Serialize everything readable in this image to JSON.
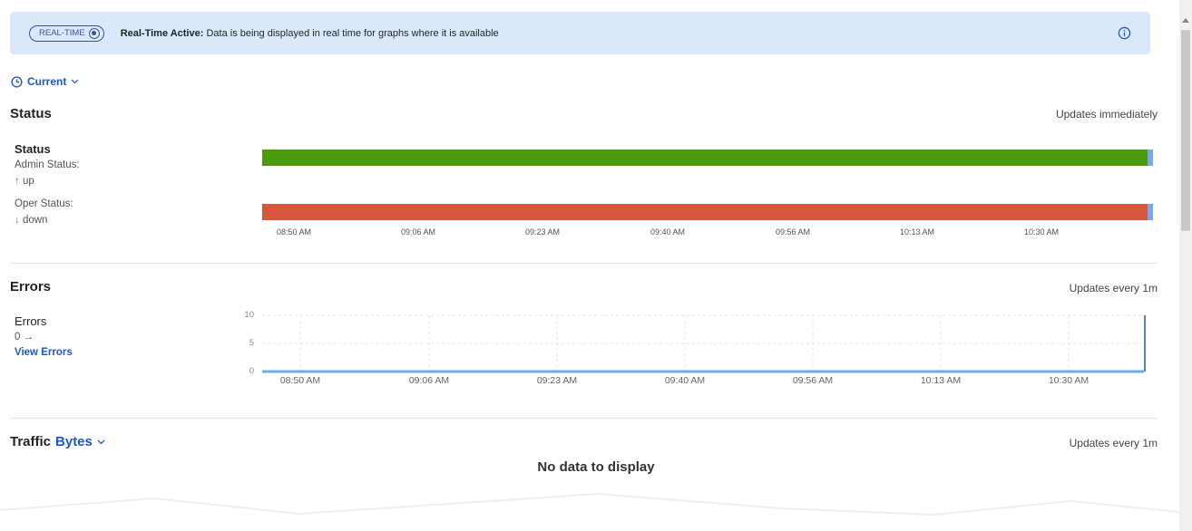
{
  "banner": {
    "pill_label": "REAL-TIME",
    "title": "Real-Time Active:",
    "message": "Data is being displayed in real time for graphs where it is available"
  },
  "time_range": {
    "label": "Current"
  },
  "status_section": {
    "title": "Status",
    "updates": "Updates immediately",
    "group_title": "Status",
    "admin_label": "Admin Status:",
    "admin_value": "up",
    "oper_label": "Oper Status:",
    "oper_value": "down",
    "x_ticks": [
      "08:50 AM",
      "09:06 AM",
      "09:23 AM",
      "09:40 AM",
      "09:56 AM",
      "10:13 AM",
      "10:30 AM"
    ]
  },
  "errors_section": {
    "title": "Errors",
    "updates": "Updates every 1m",
    "group_title": "Errors",
    "value": "0",
    "link": "View Errors",
    "y_ticks": [
      "10",
      "5",
      "0"
    ],
    "x_ticks": [
      "08:50 AM",
      "09:06 AM",
      "09:23 AM",
      "09:40 AM",
      "09:56 AM",
      "10:13 AM",
      "10:30 AM"
    ]
  },
  "chart_data": {
    "type": "line",
    "series": [
      {
        "values": [
          0,
          0,
          0,
          0,
          0,
          0,
          0
        ]
      }
    ],
    "categories": [
      "08:50 AM",
      "09:06 AM",
      "09:23 AM",
      "09:40 AM",
      "09:56 AM",
      "10:13 AM",
      "10:30 AM"
    ],
    "ylim": [
      0,
      10
    ],
    "yticks": [
      0,
      5,
      10
    ],
    "grid": true
  },
  "traffic_section": {
    "title": "Traffic",
    "unit": "Bytes",
    "updates": "Updates every 1m",
    "empty": "No data to display"
  },
  "colors": {
    "accent": "#1d5ac7",
    "banner_bg": "#dbe8fb",
    "up_green": "#4e9a0d",
    "down_red": "#d9563d",
    "line_blue": "#6aaee6"
  }
}
